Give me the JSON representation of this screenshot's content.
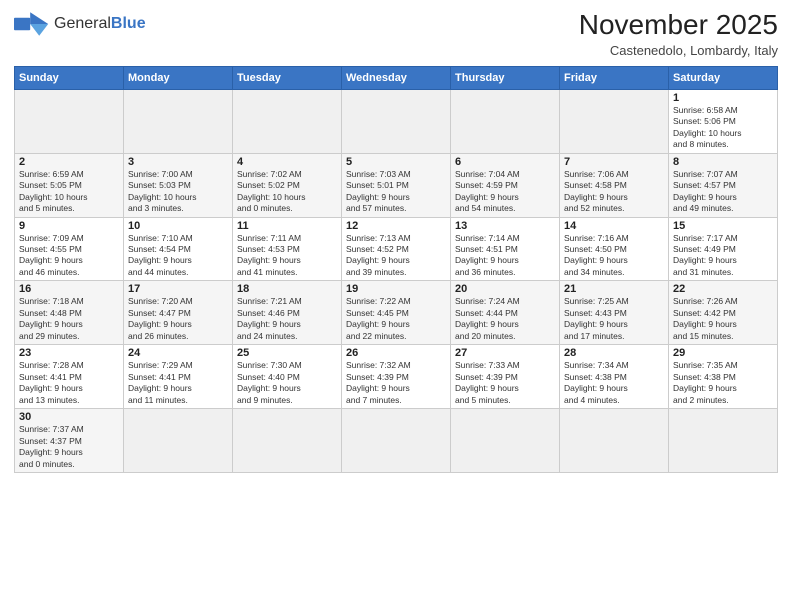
{
  "logo": {
    "text_general": "General",
    "text_blue": "Blue"
  },
  "header": {
    "month_title": "November 2025",
    "subtitle": "Castenedolo, Lombardy, Italy"
  },
  "weekdays": [
    "Sunday",
    "Monday",
    "Tuesday",
    "Wednesday",
    "Thursday",
    "Friday",
    "Saturday"
  ],
  "weeks": [
    [
      {
        "day": "",
        "info": ""
      },
      {
        "day": "",
        "info": ""
      },
      {
        "day": "",
        "info": ""
      },
      {
        "day": "",
        "info": ""
      },
      {
        "day": "",
        "info": ""
      },
      {
        "day": "",
        "info": ""
      },
      {
        "day": "1",
        "info": "Sunrise: 6:58 AM\nSunset: 5:06 PM\nDaylight: 10 hours\nand 8 minutes."
      }
    ],
    [
      {
        "day": "2",
        "info": "Sunrise: 6:59 AM\nSunset: 5:05 PM\nDaylight: 10 hours\nand 5 minutes."
      },
      {
        "day": "3",
        "info": "Sunrise: 7:00 AM\nSunset: 5:03 PM\nDaylight: 10 hours\nand 3 minutes."
      },
      {
        "day": "4",
        "info": "Sunrise: 7:02 AM\nSunset: 5:02 PM\nDaylight: 10 hours\nand 0 minutes."
      },
      {
        "day": "5",
        "info": "Sunrise: 7:03 AM\nSunset: 5:01 PM\nDaylight: 9 hours\nand 57 minutes."
      },
      {
        "day": "6",
        "info": "Sunrise: 7:04 AM\nSunset: 4:59 PM\nDaylight: 9 hours\nand 54 minutes."
      },
      {
        "day": "7",
        "info": "Sunrise: 7:06 AM\nSunset: 4:58 PM\nDaylight: 9 hours\nand 52 minutes."
      },
      {
        "day": "8",
        "info": "Sunrise: 7:07 AM\nSunset: 4:57 PM\nDaylight: 9 hours\nand 49 minutes."
      }
    ],
    [
      {
        "day": "9",
        "info": "Sunrise: 7:09 AM\nSunset: 4:55 PM\nDaylight: 9 hours\nand 46 minutes."
      },
      {
        "day": "10",
        "info": "Sunrise: 7:10 AM\nSunset: 4:54 PM\nDaylight: 9 hours\nand 44 minutes."
      },
      {
        "day": "11",
        "info": "Sunrise: 7:11 AM\nSunset: 4:53 PM\nDaylight: 9 hours\nand 41 minutes."
      },
      {
        "day": "12",
        "info": "Sunrise: 7:13 AM\nSunset: 4:52 PM\nDaylight: 9 hours\nand 39 minutes."
      },
      {
        "day": "13",
        "info": "Sunrise: 7:14 AM\nSunset: 4:51 PM\nDaylight: 9 hours\nand 36 minutes."
      },
      {
        "day": "14",
        "info": "Sunrise: 7:16 AM\nSunset: 4:50 PM\nDaylight: 9 hours\nand 34 minutes."
      },
      {
        "day": "15",
        "info": "Sunrise: 7:17 AM\nSunset: 4:49 PM\nDaylight: 9 hours\nand 31 minutes."
      }
    ],
    [
      {
        "day": "16",
        "info": "Sunrise: 7:18 AM\nSunset: 4:48 PM\nDaylight: 9 hours\nand 29 minutes."
      },
      {
        "day": "17",
        "info": "Sunrise: 7:20 AM\nSunset: 4:47 PM\nDaylight: 9 hours\nand 26 minutes."
      },
      {
        "day": "18",
        "info": "Sunrise: 7:21 AM\nSunset: 4:46 PM\nDaylight: 9 hours\nand 24 minutes."
      },
      {
        "day": "19",
        "info": "Sunrise: 7:22 AM\nSunset: 4:45 PM\nDaylight: 9 hours\nand 22 minutes."
      },
      {
        "day": "20",
        "info": "Sunrise: 7:24 AM\nSunset: 4:44 PM\nDaylight: 9 hours\nand 20 minutes."
      },
      {
        "day": "21",
        "info": "Sunrise: 7:25 AM\nSunset: 4:43 PM\nDaylight: 9 hours\nand 17 minutes."
      },
      {
        "day": "22",
        "info": "Sunrise: 7:26 AM\nSunset: 4:42 PM\nDaylight: 9 hours\nand 15 minutes."
      }
    ],
    [
      {
        "day": "23",
        "info": "Sunrise: 7:28 AM\nSunset: 4:41 PM\nDaylight: 9 hours\nand 13 minutes."
      },
      {
        "day": "24",
        "info": "Sunrise: 7:29 AM\nSunset: 4:41 PM\nDaylight: 9 hours\nand 11 minutes."
      },
      {
        "day": "25",
        "info": "Sunrise: 7:30 AM\nSunset: 4:40 PM\nDaylight: 9 hours\nand 9 minutes."
      },
      {
        "day": "26",
        "info": "Sunrise: 7:32 AM\nSunset: 4:39 PM\nDaylight: 9 hours\nand 7 minutes."
      },
      {
        "day": "27",
        "info": "Sunrise: 7:33 AM\nSunset: 4:39 PM\nDaylight: 9 hours\nand 5 minutes."
      },
      {
        "day": "28",
        "info": "Sunrise: 7:34 AM\nSunset: 4:38 PM\nDaylight: 9 hours\nand 4 minutes."
      },
      {
        "day": "29",
        "info": "Sunrise: 7:35 AM\nSunset: 4:38 PM\nDaylight: 9 hours\nand 2 minutes."
      }
    ],
    [
      {
        "day": "30",
        "info": "Sunrise: 7:37 AM\nSunset: 4:37 PM\nDaylight: 9 hours\nand 0 minutes."
      },
      {
        "day": "",
        "info": ""
      },
      {
        "day": "",
        "info": ""
      },
      {
        "day": "",
        "info": ""
      },
      {
        "day": "",
        "info": ""
      },
      {
        "day": "",
        "info": ""
      },
      {
        "day": "",
        "info": ""
      }
    ]
  ]
}
